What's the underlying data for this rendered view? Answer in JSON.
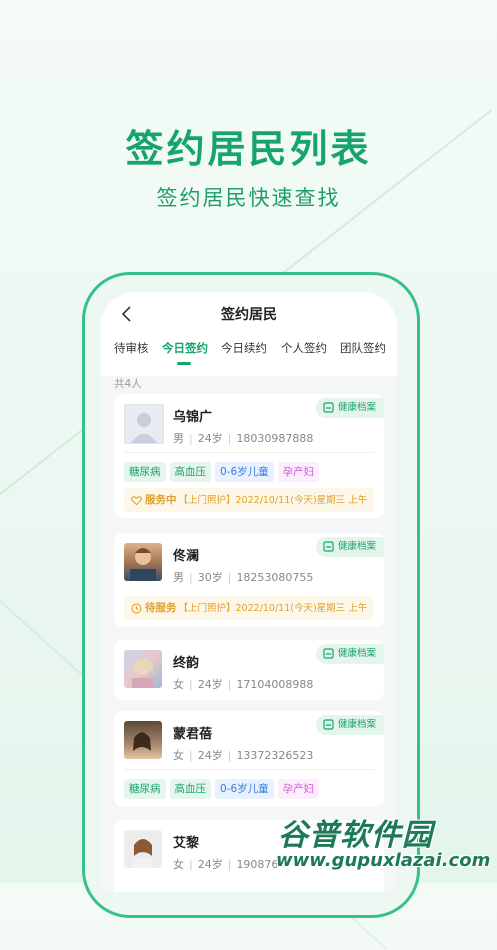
{
  "hero": {
    "title": "签约居民列表",
    "subtitle": "签约居民快速查找"
  },
  "nav": {
    "title": "签约居民"
  },
  "tabs": [
    "待审核",
    "今日签约",
    "今日续约",
    "个人签约",
    "团队签约"
  ],
  "active_tab": "今日签约",
  "count_label": "共4人",
  "archive_label": "健康档案",
  "residents": [
    {
      "name": "乌锦广",
      "gender": "男",
      "age": "24岁",
      "phone": "18030987888",
      "tags": [
        "糖尿病",
        "高血压",
        "0-6岁儿童",
        "孕产妇"
      ],
      "service": {
        "status": "服务中",
        "type": "【上门照护】",
        "time": "2022/10/11(今天)星期三 上午"
      }
    },
    {
      "name": "佟澜",
      "gender": "男",
      "age": "30岁",
      "phone": "18253080755",
      "service": {
        "status": "待服务",
        "type": "【上门照护】",
        "time": "2022/10/11(今天)星期三 上午"
      }
    },
    {
      "name": "终韵",
      "gender": "女",
      "age": "24岁",
      "phone": "17104008988"
    },
    {
      "name": "蒙君蓓",
      "gender": "女",
      "age": "24岁",
      "phone": "13372326523",
      "tags": [
        "糖尿病",
        "高血压",
        "0-6岁儿童",
        "孕产妇"
      ]
    },
    {
      "name": "艾黎",
      "gender": "女",
      "age": "24岁",
      "phone": "190876"
    }
  ],
  "watermark": {
    "name": "谷普软件园",
    "url": "www.gupuxlazai.com"
  },
  "colors": {
    "accent": "#17a46b",
    "warning": "#e0a12e",
    "blue": "#3a7be0",
    "pink": "#d05ad8"
  }
}
